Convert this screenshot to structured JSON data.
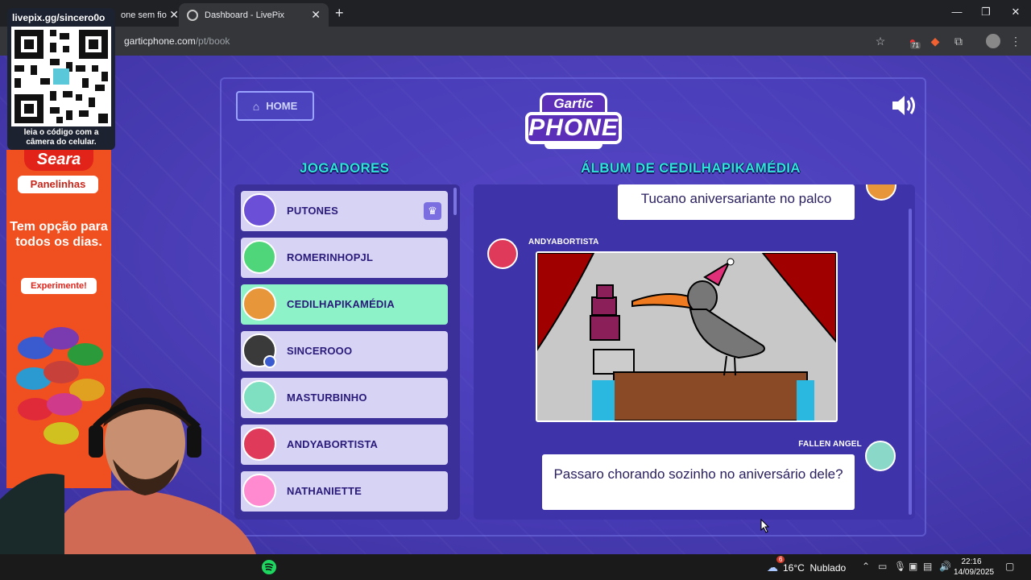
{
  "browser": {
    "tabs": [
      {
        "title": "one sem fio",
        "active": false
      },
      {
        "title": "Dashboard - LivePix",
        "active": true
      }
    ],
    "url_host": "garticphone.com",
    "url_path": "/pt/book",
    "extension_badge": "71"
  },
  "game": {
    "home_label": "HOME",
    "logo_top": "Gartic",
    "logo_bottom": "PHONE",
    "players_title": "JOGADORES",
    "album_title": "ÁLBUM DE CEDILHAPIKAMÉDIA",
    "players": [
      {
        "name": "PUTONES",
        "host": true,
        "active": false,
        "color": "#6b4fd6"
      },
      {
        "name": "ROMERINHOPJL",
        "host": false,
        "active": false,
        "color": "#4fd67a"
      },
      {
        "name": "CEDILHAPIKAMÉDIA",
        "host": false,
        "active": true,
        "color": "#e8963a"
      },
      {
        "name": "SINCEROOO",
        "host": false,
        "active": false,
        "color": "#3a3a3a"
      },
      {
        "name": "MASTURBINHO",
        "host": false,
        "active": false,
        "color": "#7ee0c0"
      },
      {
        "name": "ANDYABORTISTA",
        "host": false,
        "active": false,
        "color": "#e03a5a"
      },
      {
        "name": "NATHANIETTE",
        "host": false,
        "active": false,
        "color": "#ff8ad0"
      }
    ],
    "album": {
      "entries": [
        {
          "type": "text",
          "text": "Tucano aniversariante no palco"
        },
        {
          "type": "drawing",
          "author": "ANDYABORTISTA"
        },
        {
          "type": "text",
          "author": "FALLEN ANGEL",
          "text": "Passaro chorando sozinho no aniversário dele?"
        }
      ]
    }
  },
  "overlay": {
    "qr_handle": "livepix.gg/sincero0o",
    "qr_caption": "leia o código com a câmera do celular.",
    "ad_brand": "Seara",
    "ad_sub": "Panelinhas",
    "ad_headline": "Tem opção para todos os dias.",
    "ad_cta": "Experimente!"
  },
  "taskbar": {
    "weather": "16°C  Nublado",
    "weather_badge": "6",
    "time": "22:16",
    "date": "14/09/2025"
  }
}
